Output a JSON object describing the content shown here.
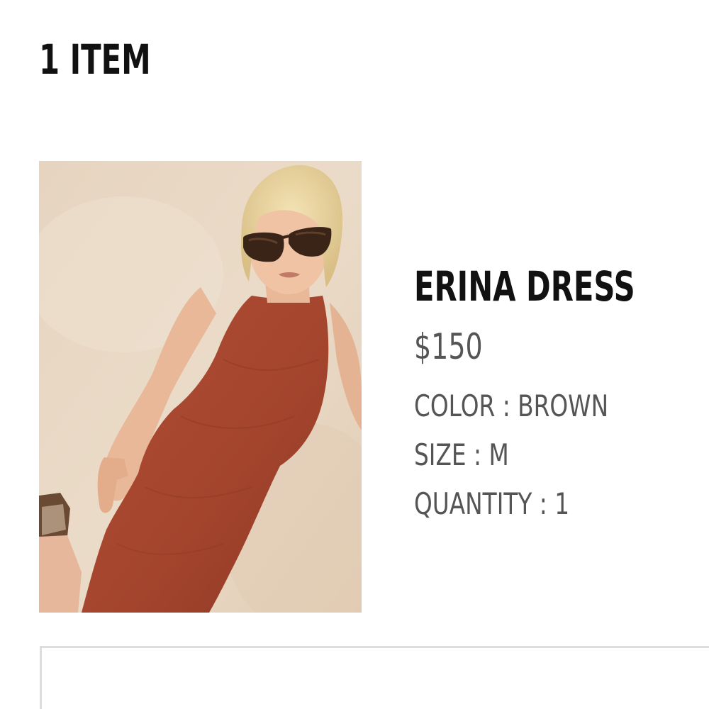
{
  "cart": {
    "item_count_label": "1 ITEM"
  },
  "product": {
    "name": "ERINA DRESS",
    "price": "$150",
    "image_alt": "Model wearing brown ribbed sleeveless midi dress",
    "attributes": {
      "color": "COLOR : BROWN",
      "size": "SIZE : M",
      "quantity": "QUANTITY : 1"
    }
  },
  "colors": {
    "heading_text": "#111111",
    "secondary_text": "#555555",
    "dress_brown": "#a3442d",
    "background_beige": "#e9d8c4",
    "border_gray": "#dddddd"
  }
}
